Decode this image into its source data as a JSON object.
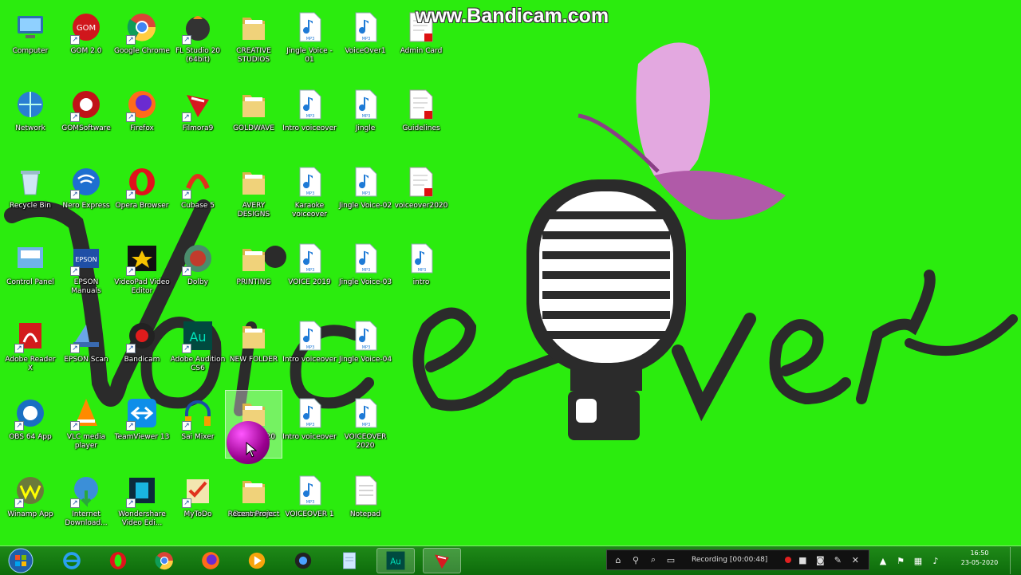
{
  "watermark": "www.Bandicam.com",
  "wallpaper": {
    "title_word": "Voice over",
    "background_color": "#2bec0e"
  },
  "desktop_icons": [
    {
      "label": "Computer",
      "icon": "computer-icon"
    },
    {
      "label": "Network",
      "icon": "network-icon"
    },
    {
      "label": "Recycle Bin",
      "icon": "recycle-bin-icon"
    },
    {
      "label": "Control Panel",
      "icon": "control-panel-icon"
    },
    {
      "label": "Adobe Reader X",
      "icon": "pdf-icon"
    },
    {
      "label": "OBS 64 App",
      "icon": "obs-icon"
    },
    {
      "label": "Winamp App",
      "icon": "winamp-icon"
    },
    {
      "label": "GOM 2.0",
      "icon": "gom-icon"
    },
    {
      "label": "GOMSoftware",
      "icon": "gom-software-icon"
    },
    {
      "label": "Nero Express",
      "icon": "wireless-icon"
    },
    {
      "label": "EPSON Manuals",
      "icon": "epson-icon"
    },
    {
      "label": "EPSON Scan",
      "icon": "scanner-icon"
    },
    {
      "label": "VLC media player",
      "icon": "vlc-icon"
    },
    {
      "label": "Internet Download...",
      "icon": "download-globe-icon"
    },
    {
      "label": "Google Chrome",
      "icon": "chrome-icon"
    },
    {
      "label": "Firefox",
      "icon": "firefox-icon"
    },
    {
      "label": "Opera Browser",
      "icon": "opera-icon"
    },
    {
      "label": "VideoPad Video Editor",
      "icon": "videopad-icon"
    },
    {
      "label": "Bandicam",
      "icon": "bandicam-icon"
    },
    {
      "label": "TeamViewer 13",
      "icon": "teamviewer-icon"
    },
    {
      "label": "Wondershare Video Edi...",
      "icon": "film-icon"
    },
    {
      "label": "FL Studio 20 (64bit)",
      "icon": "fl-studio-icon"
    },
    {
      "label": "Filmora9",
      "icon": "filmora-icon"
    },
    {
      "label": "Cubase 5",
      "icon": "cubase-icon"
    },
    {
      "label": "Dolby",
      "icon": "dolby-icon"
    },
    {
      "label": "Adobe Audition CS6",
      "icon": "audition-icon"
    },
    {
      "label": "Sai Mixer",
      "icon": "headphones-icon"
    },
    {
      "label": "MyToDo",
      "icon": "checklist-icon"
    },
    {
      "label": "CREATIVE STUDIOS",
      "icon": "folder-icon"
    },
    {
      "label": "GOLDWAVE",
      "icon": "folder-icon"
    },
    {
      "label": "AVERY DESIGNS",
      "icon": "folder-icon"
    },
    {
      "label": "PRINTING",
      "icon": "folder-icon"
    },
    {
      "label": "NEW FOLDER",
      "icon": "folder-icon"
    },
    {
      "label": "Documents",
      "icon": "folder-icon"
    },
    {
      "label": "Recent Project",
      "icon": "folder-icon"
    },
    {
      "label": "VIDEO 2020",
      "icon": "folder-icon"
    },
    {
      "label": "Jingle Voice - 01",
      "icon": "mp3-file-icon"
    },
    {
      "label": "Intro voiceover",
      "icon": "mp3-file-icon"
    },
    {
      "label": "Karaoke voiceover",
      "icon": "mp3-file-icon"
    },
    {
      "label": "VOICE 2019",
      "icon": "mp3-file-icon"
    },
    {
      "label": "Intro voiceover",
      "icon": "mp3-file-icon"
    },
    {
      "label": "Intro voiceover",
      "icon": "mp3-file-icon"
    },
    {
      "label": "VOICEOVER 1",
      "icon": "mp3-file-icon"
    },
    {
      "label": "VoiceOver1",
      "icon": "mp3-file-icon"
    },
    {
      "label": "Jingle",
      "icon": "mp3-file-icon"
    },
    {
      "label": "Jingle Voice-02",
      "icon": "mp3-file-icon"
    },
    {
      "label": "Jingle Voice-03",
      "icon": "mp3-file-icon"
    },
    {
      "label": "Jingle Voice-04",
      "icon": "mp3-file-icon"
    },
    {
      "label": "VOICEOVER 2020",
      "icon": "mp3-file-icon"
    },
    {
      "label": "Notepad",
      "icon": "document-icon"
    },
    {
      "label": "Admin Card",
      "icon": "document-pdf-icon"
    },
    {
      "label": "Guidelines",
      "icon": "document-pdf-icon"
    },
    {
      "label": "voiceover2020",
      "icon": "document-pdf-icon"
    },
    {
      "label": "intro",
      "icon": "mp3-file-icon"
    }
  ],
  "taskbar": {
    "start_label": "Start",
    "pinned": [
      {
        "name": "internet-explorer",
        "icon": "ie-icon"
      },
      {
        "name": "opera",
        "icon": "opera-icon"
      },
      {
        "name": "chrome",
        "icon": "chrome-icon"
      },
      {
        "name": "firefox",
        "icon": "firefox-icon"
      },
      {
        "name": "media-player",
        "icon": "media-player-icon"
      },
      {
        "name": "audacity",
        "icon": "audio-editor-icon"
      },
      {
        "name": "notepad",
        "icon": "notepad-icon"
      },
      {
        "name": "adobe-audition",
        "icon": "audition-icon"
      },
      {
        "name": "filmora",
        "icon": "filmora-icon"
      }
    ],
    "recording_status": "Recording [00:00:48]",
    "clock_time": "16:50",
    "clock_date": "23-05-2020"
  },
  "colors": {
    "desktop_green": "#2bec0e",
    "taskbar_green": "#0d6b0b",
    "rec_red": "#e02020"
  }
}
